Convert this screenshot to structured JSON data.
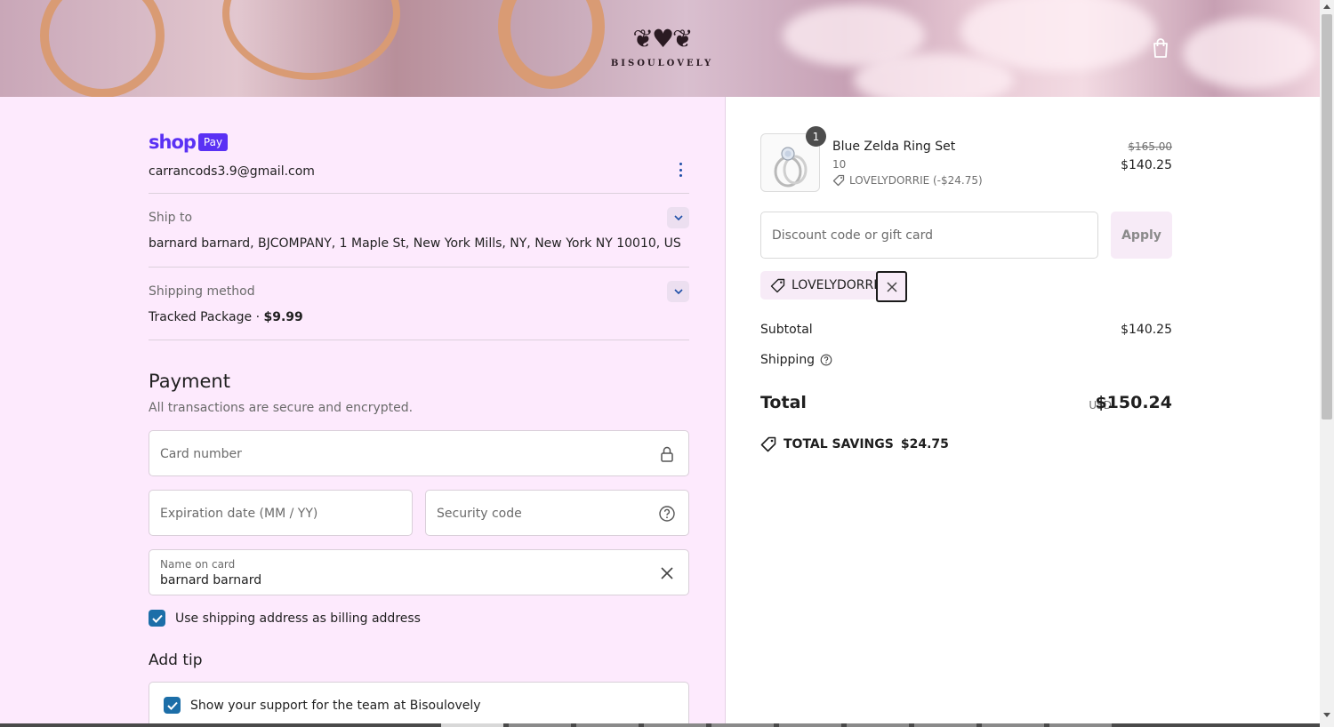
{
  "header": {
    "logo_text": "BISOULOVELY",
    "logo_mark": "❦♥❦",
    "bag_icon": "shopping-bag-icon"
  },
  "account": {
    "shop_word": "shop",
    "pay_badge": "Pay",
    "email": "carrancods3.9@gmail.com"
  },
  "ship_to": {
    "label": "Ship to",
    "value": "barnard barnard, BJCOMPANY, 1 Maple St, New York Mills, NY, New York NY 10010, US"
  },
  "shipping_method": {
    "label": "Shipping method",
    "value": "Tracked Package · ",
    "price": "$9.99"
  },
  "payment": {
    "title": "Payment",
    "subtitle": "All transactions are secure and encrypted.",
    "card_number_placeholder": "Card number",
    "expiration_placeholder": "Expiration date (MM / YY)",
    "security_placeholder": "Security code",
    "name_label": "Name on card",
    "name_value": "barnard barnard",
    "billing_checkbox_label": "Use shipping address as billing address"
  },
  "tip": {
    "title": "Add tip",
    "support_label": "Show your support for the team at Bisoulovely"
  },
  "order": {
    "quantity": "1",
    "product_name": "Blue Zelda Ring Set",
    "variant": "10",
    "discount_line": "LOVELYDORRIE (-$24.75)",
    "price_original": "$165.00",
    "price_current": "$140.25",
    "discount_placeholder": "Discount code or gift card",
    "apply_label": "Apply",
    "applied_code": "LOVELYDORRIE",
    "subtotal_label": "Subtotal",
    "subtotal_value": "$140.25",
    "shipping_label": "Shipping",
    "total_label": "Total",
    "currency": "USD",
    "total_value": "$150.24",
    "savings_label": "TOTAL SAVINGS",
    "savings_value": "$24.75"
  },
  "colors": {
    "shop_pay": "#5a31f4",
    "checkbox": "#1c6ea8",
    "page_bg": "#fdeafd"
  }
}
